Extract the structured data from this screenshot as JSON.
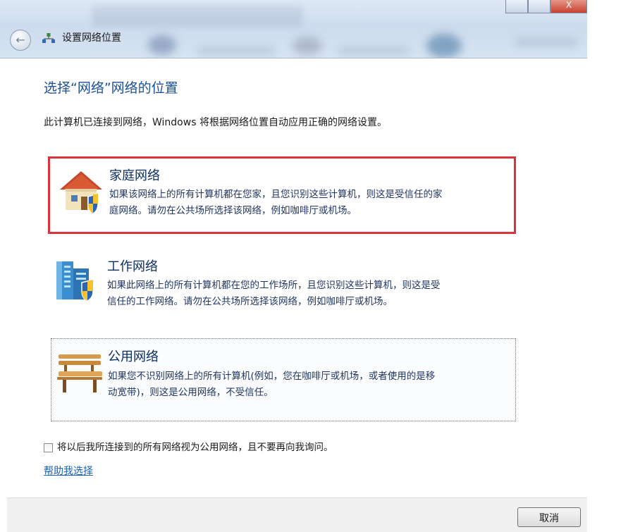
{
  "window": {
    "title": "设置网络位置",
    "controls": {
      "minimize": "",
      "maximize": "",
      "close": "X"
    },
    "back_icon": "back-arrow-icon",
    "network_icon": "network-icon"
  },
  "main": {
    "heading": "选择“网络”网络的位置",
    "intro": "此计算机已连接到网络，Windows 将根据网络位置自动应用正确的网络设置。",
    "options": [
      {
        "title": "家庭网络",
        "desc_line1": "如果该网络上的所有计算机都在您家，且您识别这些计算机，则这是受信任的家",
        "desc_line2": "庭网络。请勿在公共场所选择该网络，例如咖啡厅或机场。",
        "icon": "house-shield-icon",
        "state": "selected"
      },
      {
        "title": "工作网络",
        "desc_line1": "如果此网络上的所有计算机都在您的工作场所，且您识别这些计算机，则这是受",
        "desc_line2": "信任的工作网络。请勿在公共场所选择该网络，例如咖啡厅或机场。",
        "icon": "office-building-shield-icon",
        "state": "normal"
      },
      {
        "title": "公用网络",
        "desc_line1": "如果您不识别网络上的所有计算机(例如，您在咖啡厅或机场，或者使用的是移",
        "desc_line2": "动宽带)，则这是公用网络，不受信任。",
        "icon": "park-bench-icon",
        "state": "focused"
      }
    ],
    "checkbox": {
      "label": "将以后我所连接到的所有网络视为公用网络，且不要再向我询问。",
      "checked": false
    },
    "help_link": "帮助我选择"
  },
  "footer": {
    "cancel_label": "取消"
  },
  "colors": {
    "heading": "#1b4f96",
    "selected_border": "#d9343a",
    "link": "#1a63b5",
    "title_text": "#0d2e63"
  }
}
